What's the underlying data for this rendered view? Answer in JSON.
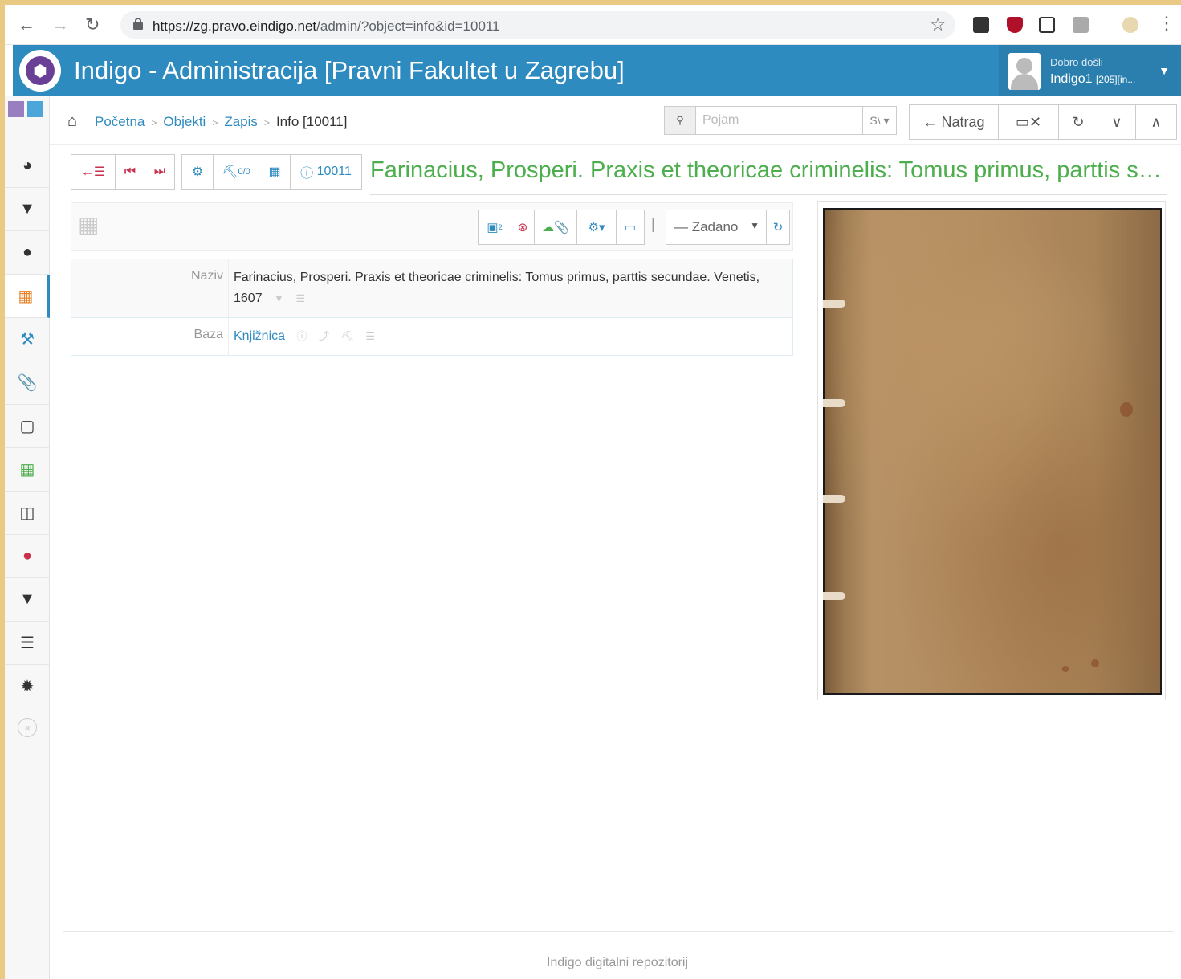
{
  "browser": {
    "url_domain": "https://zg.pravo.eindigo.net",
    "url_path": "/admin/?object=info&id=10011"
  },
  "app": {
    "title": "Indigo - Administracija [Pravni Fakultet u Zagrebu]",
    "welcome": "Dobro došli",
    "username": "Indigo1",
    "user_suffix": "[205][in..."
  },
  "breadcrumb": {
    "items": [
      "Početna",
      "Objekti",
      "Zapis"
    ],
    "current": "Info [10011]"
  },
  "search": {
    "placeholder": "Pojam",
    "select": "S\\"
  },
  "toolbar": {
    "back_label": "Natrag"
  },
  "record": {
    "id_label": "10011",
    "tree_count": "0/0",
    "title": "Farinacius, Prosperi. Praxis et theoricae criminelis: Tomus primus, parttis secundae. Venetis, 1607",
    "panel_number": "2",
    "view_select": "— Zadano"
  },
  "info": {
    "rows": [
      {
        "label": "Naziv",
        "value": "Farinacius, Prosperi. Praxis et theoricae criminelis: Tomus primus, parttis secundae. Venetis, 1607"
      },
      {
        "label": "Baza",
        "value": "Knjižnica"
      }
    ]
  },
  "footer": {
    "text": "Indigo digitalni repozitorij"
  },
  "colors": {
    "header": "#2e8bc0",
    "title_green": "#4cae4c",
    "nav_red": "#c7314c",
    "logo_purple": "#6a3f96"
  },
  "sidebar": {
    "icons": [
      "dashboard-icon",
      "filter-icon",
      "user-icon",
      "puzzle-icon",
      "gavel-icon",
      "paperclip-icon",
      "square-icon",
      "table-icon",
      "columns-icon",
      "user-red-icon",
      "filter-icon",
      "server-icon",
      "bug-icon"
    ]
  }
}
